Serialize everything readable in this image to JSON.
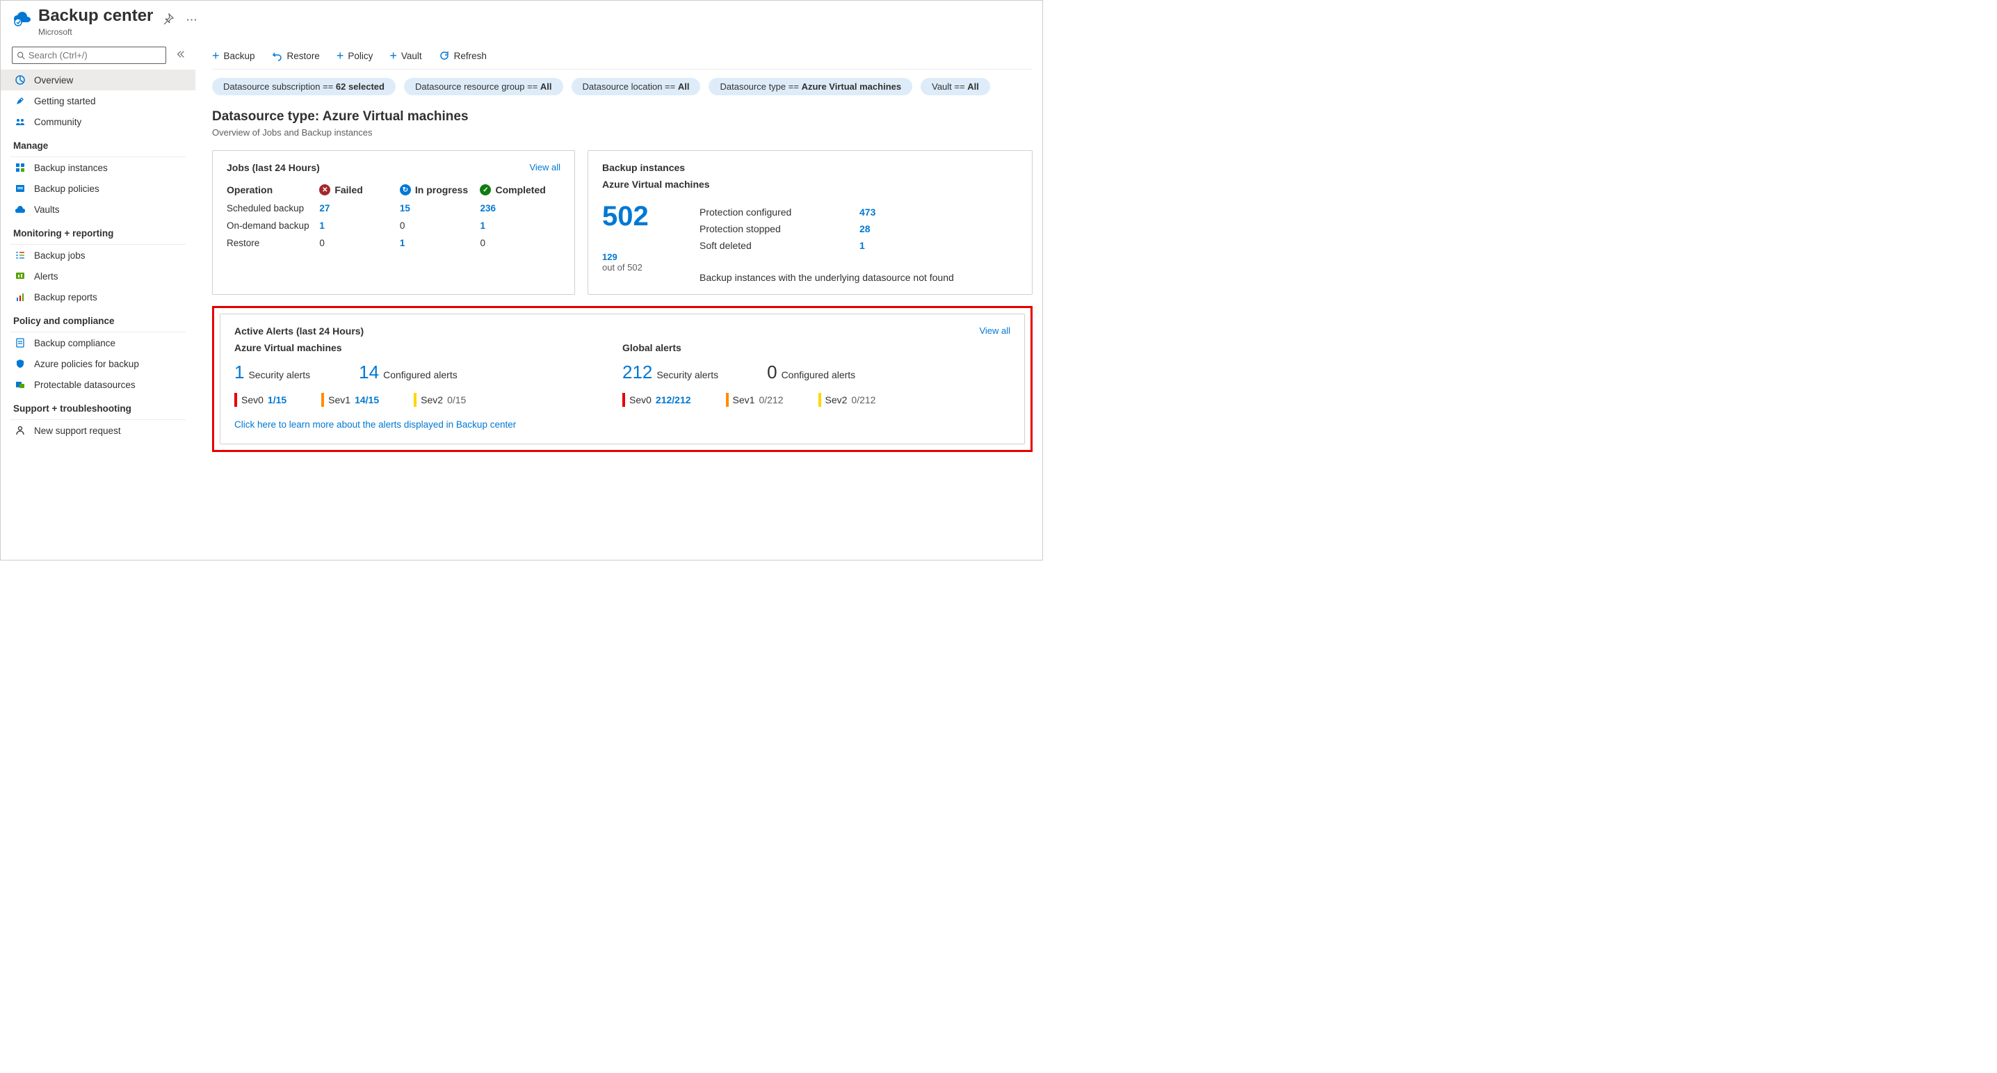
{
  "header": {
    "title": "Backup center",
    "subtitle": "Microsoft"
  },
  "search": {
    "placeholder": "Search (Ctrl+/)"
  },
  "nav": {
    "top": [
      {
        "label": "Overview"
      },
      {
        "label": "Getting started"
      },
      {
        "label": "Community"
      }
    ],
    "sections": [
      {
        "title": "Manage",
        "items": [
          {
            "label": "Backup instances"
          },
          {
            "label": "Backup policies"
          },
          {
            "label": "Vaults"
          }
        ]
      },
      {
        "title": "Monitoring + reporting",
        "items": [
          {
            "label": "Backup jobs"
          },
          {
            "label": "Alerts"
          },
          {
            "label": "Backup reports"
          }
        ]
      },
      {
        "title": "Policy and compliance",
        "items": [
          {
            "label": "Backup compliance"
          },
          {
            "label": "Azure policies for backup"
          },
          {
            "label": "Protectable datasources"
          }
        ]
      },
      {
        "title": "Support + troubleshooting",
        "items": [
          {
            "label": "New support request"
          }
        ]
      }
    ]
  },
  "toolbar": {
    "backup": "Backup",
    "restore": "Restore",
    "policy": "Policy",
    "vault": "Vault",
    "refresh": "Refresh"
  },
  "filters": {
    "sub_prefix": "Datasource subscription == ",
    "sub_val": "62 selected",
    "rg_prefix": "Datasource resource group == ",
    "rg_val": "All",
    "loc_prefix": "Datasource location == ",
    "loc_val": "All",
    "type_prefix": "Datasource type == ",
    "type_val": "Azure Virtual machines",
    "vault_prefix": "Vault == ",
    "vault_val": "All"
  },
  "section": {
    "title": "Datasource type: Azure Virtual machines",
    "sub": "Overview of Jobs and Backup instances"
  },
  "jobs": {
    "title": "Jobs (last 24 Hours)",
    "view_all": "View all",
    "hdr_op": "Operation",
    "hdr_failed": "Failed",
    "hdr_prog": "In progress",
    "hdr_comp": "Completed",
    "rows": [
      {
        "op": "Scheduled backup",
        "failed": "27",
        "prog": "15",
        "comp": "236"
      },
      {
        "op": "On-demand backup",
        "failed": "1",
        "prog": "0",
        "comp": "1"
      },
      {
        "op": "Restore",
        "failed": "0",
        "prog": "1",
        "comp": "0"
      }
    ]
  },
  "instances": {
    "title": "Backup instances",
    "subtype": "Azure Virtual machines",
    "total": "502",
    "notfound": "129",
    "notfound_of": "out of 502",
    "desc": "Backup instances with the underlying datasource not found",
    "rows": [
      {
        "lbl": "Protection configured",
        "val": "473"
      },
      {
        "lbl": "Protection stopped",
        "val": "28"
      },
      {
        "lbl": "Soft deleted",
        "val": "1"
      }
    ]
  },
  "alerts": {
    "title": "Active Alerts (last 24 Hours)",
    "view_all": "View all",
    "learn_more": "Click here to learn more about the alerts displayed in Backup center",
    "vm": {
      "title": "Azure Virtual machines",
      "security_n": "1",
      "security_lbl": "Security alerts",
      "config_n": "14",
      "config_lbl": "Configured alerts",
      "sev": [
        {
          "name": "Sev0",
          "val": "1/15",
          "link": true
        },
        {
          "name": "Sev1",
          "val": "14/15",
          "link": true
        },
        {
          "name": "Sev2",
          "val": "0/15",
          "link": false
        }
      ]
    },
    "global": {
      "title": "Global alerts",
      "security_n": "212",
      "security_lbl": "Security alerts",
      "config_n": "0",
      "config_lbl": "Configured alerts",
      "sev": [
        {
          "name": "Sev0",
          "val": "212/212",
          "link": true
        },
        {
          "name": "Sev1",
          "val": "0/212",
          "link": false
        },
        {
          "name": "Sev2",
          "val": "0/212",
          "link": false
        }
      ]
    }
  }
}
